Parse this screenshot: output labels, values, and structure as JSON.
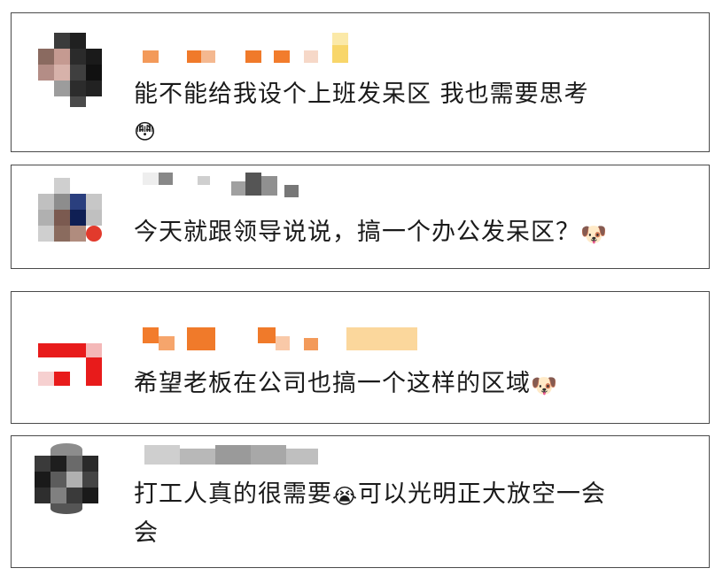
{
  "comments": [
    {
      "text": "能不能给我设个上班发呆区 我也需要思考",
      "emoji": "😳"
    },
    {
      "text": "今天就跟领导说说，搞一个办公发呆区？",
      "emoji": "🐶"
    },
    {
      "text": "希望老板在公司也搞一个这样的区域",
      "emoji": "🐶"
    },
    {
      "text_line1": "打工人真的很需要",
      "emoji": "😭",
      "text_line1_after": "可以光明正大放空一会",
      "text_line2": "会"
    }
  ]
}
